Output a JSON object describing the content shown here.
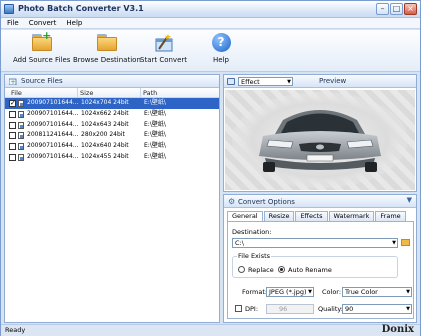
{
  "window": {
    "title": "Photo Batch Converter V3.1"
  },
  "menu": [
    "File",
    "Convert",
    "Help"
  ],
  "toolbar": {
    "add_source": "Add Source Files",
    "browse_dest": "Browse Destination",
    "start_convert": "Start Convert",
    "help": "Help"
  },
  "source_panel": {
    "title": "Source Files",
    "columns": [
      "File",
      "Size",
      "Path"
    ],
    "rows": [
      {
        "file": "200907101644...",
        "size": "1024x704  24bit",
        "path": "E:\\壁纸\\",
        "checked": true,
        "selected": true
      },
      {
        "file": "200907101644...",
        "size": "1024x662  24bit",
        "path": "E:\\壁纸\\",
        "checked": false,
        "selected": false
      },
      {
        "file": "200907101644...",
        "size": "1024x643  24bit",
        "path": "E:\\壁纸\\",
        "checked": false,
        "selected": false
      },
      {
        "file": "200811241644...",
        "size": "280x200  24bit",
        "path": "E:\\壁纸\\",
        "checked": false,
        "selected": false
      },
      {
        "file": "200907101644...",
        "size": "1024x640  24bit",
        "path": "E:\\壁纸\\",
        "checked": false,
        "selected": false
      },
      {
        "file": "200907101644...",
        "size": "1024x455  24bit",
        "path": "E:\\壁纸\\",
        "checked": false,
        "selected": false
      }
    ]
  },
  "preview": {
    "effect_value": "Effect",
    "label": "Preview"
  },
  "options": {
    "title": "Convert Options",
    "tabs": [
      "General",
      "Resize",
      "Effects",
      "Watermark",
      "Frame"
    ],
    "active_tab": "General",
    "destination_label": "Destination:",
    "destination_value": "C:\\",
    "file_exists_label": "File Exists",
    "replace_label": "Replace",
    "auto_rename_label": "Auto Rename",
    "auto_rename_selected": true,
    "format_label": "Format:",
    "format_value": "JPEG (*.jpg)",
    "color_label": "Color:",
    "color_value": "True Color",
    "dpi_label": "DPI:",
    "dpi_value": "96",
    "quality_label": "Quality:",
    "quality_value": "90"
  },
  "status": {
    "text": "Ready"
  },
  "watermark_text": "Donix"
}
